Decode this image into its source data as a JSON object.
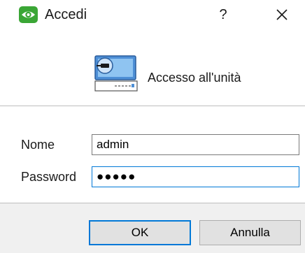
{
  "window": {
    "title": "Accedi",
    "help_label": "?",
    "app_icon": "eye-logo-icon",
    "close_icon": "close-icon"
  },
  "header": {
    "icon": "network-device-icon",
    "label": "Accesso all'unità"
  },
  "form": {
    "username_label": "Nome",
    "username_value": "admin",
    "password_label": "Password",
    "password_value": "●●●●●"
  },
  "buttons": {
    "ok_label": "OK",
    "cancel_label": "Annulla"
  },
  "colors": {
    "accent": "#0078d7",
    "logo_green": "#3aa635",
    "footer_bg": "#f0f0f0",
    "button_bg": "#e1e1e1"
  }
}
